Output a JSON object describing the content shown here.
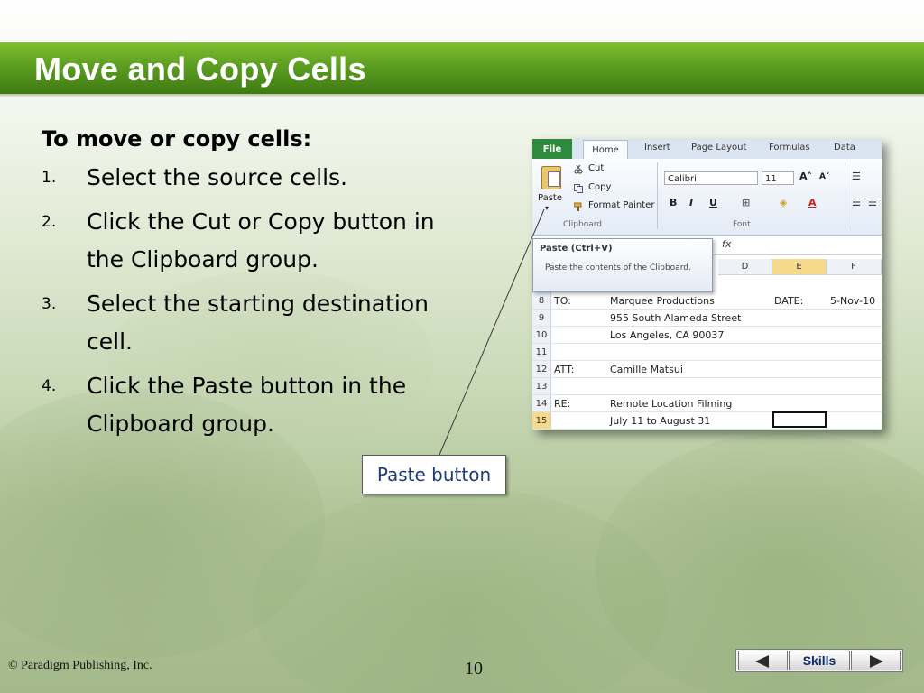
{
  "slide": {
    "title": "Move and Copy Cells",
    "heading": "To move or copy cells:",
    "steps": [
      {
        "num": "1.",
        "text": "Select the source cells."
      },
      {
        "num": "2.",
        "text": "Click the Cut or Copy button in the Clipboard group."
      },
      {
        "num": "3.",
        "text": "Select the starting destination cell."
      },
      {
        "num": "4.",
        "text": "Click the Paste button in the Clipboard group."
      }
    ],
    "callout": "Paste button"
  },
  "excel": {
    "tabs": [
      "File",
      "Home",
      "Insert",
      "Page Layout",
      "Formulas",
      "Data"
    ],
    "clipboard": {
      "paste_label": "Paste",
      "cut_label": "Cut",
      "copy_label": "Copy",
      "format_painter_label": "Format Painter",
      "group_label": "Clipboard"
    },
    "font": {
      "font_name": "Calibri",
      "font_size": "11",
      "bold": "B",
      "italic": "I",
      "underline": "U",
      "group_label": "Font"
    },
    "formula_bar": {
      "fx": "fx"
    },
    "tooltip": {
      "title": "Paste (Ctrl+V)",
      "description": "Paste the contents of the Clipboard."
    },
    "columns": [
      "D",
      "E",
      "F"
    ],
    "rows": [
      {
        "num": "8",
        "a": "TO:",
        "b": "Marquee Productions",
        "e": "DATE:",
        "f": "5-Nov-10"
      },
      {
        "num": "9",
        "a": "",
        "b": "955 South Alameda Street",
        "e": "",
        "f": ""
      },
      {
        "num": "10",
        "a": "",
        "b": "Los Angeles, CA 90037",
        "e": "",
        "f": ""
      },
      {
        "num": "11",
        "a": "",
        "b": "",
        "e": "",
        "f": ""
      },
      {
        "num": "12",
        "a": "ATT:",
        "b": "Camille Matsui",
        "e": "",
        "f": ""
      },
      {
        "num": "13",
        "a": "",
        "b": "",
        "e": "",
        "f": ""
      },
      {
        "num": "14",
        "a": "RE:",
        "b": "Remote Location Filming",
        "e": "",
        "f": ""
      },
      {
        "num": "15",
        "a": "",
        "b": "July 11 to August 31",
        "e": "",
        "f": ""
      }
    ]
  },
  "footer": {
    "copyright": "© Paradigm Publishing, Inc.",
    "page_number": "10",
    "skills_label": "Skills"
  },
  "colors": {
    "title_band": "#4f8f1d",
    "excel_file_tab": "#2e8b3d",
    "callout_text": "#1f3c7a"
  }
}
